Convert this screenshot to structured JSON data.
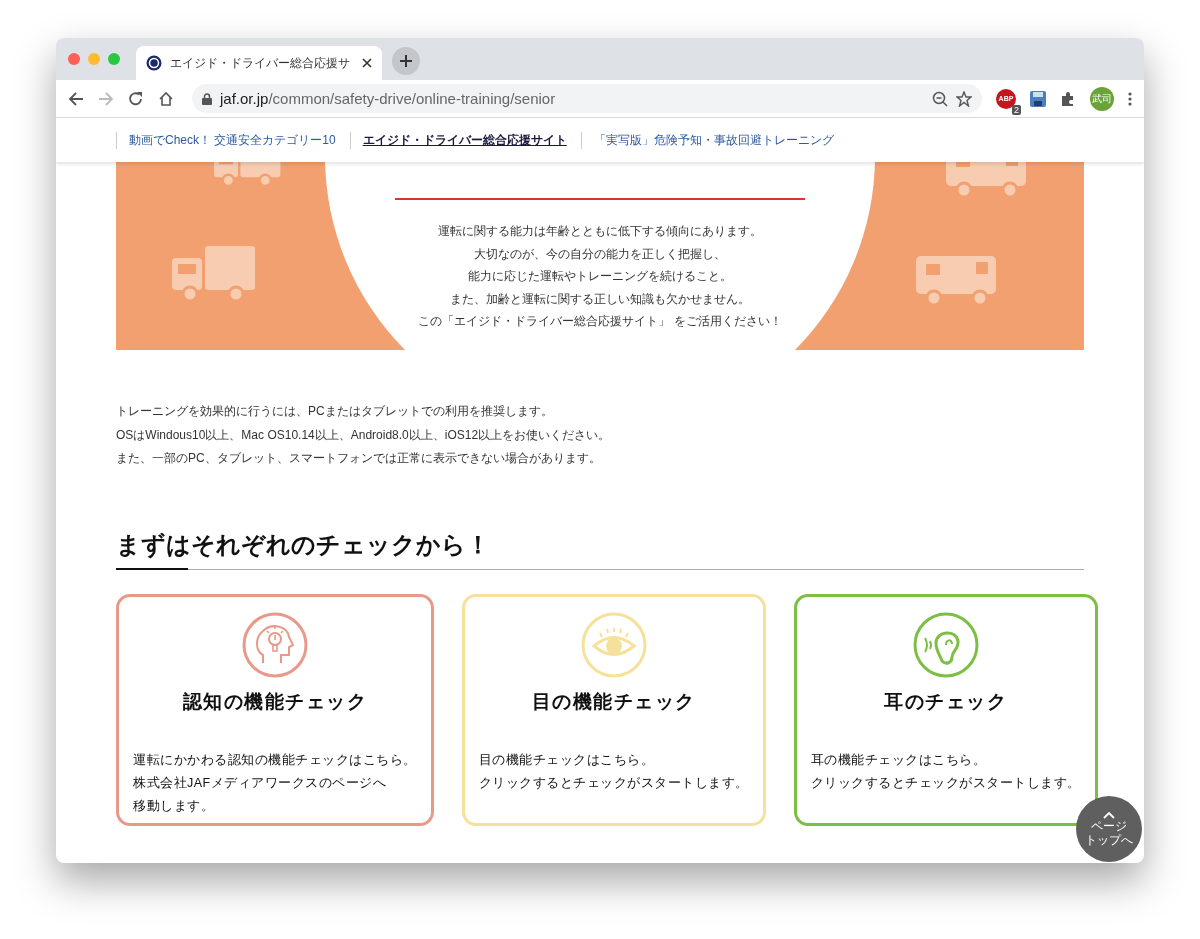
{
  "browser": {
    "tab_title": "エイジド・ドライバー総合応援サ",
    "url_domain": "jaf.or.jp",
    "url_path": "/common/safety-drive/online-training/senior",
    "extension_label": "ABP",
    "extension_badge": "2",
    "profile": "武司"
  },
  "nav_links": [
    {
      "label": "動画でCheck！ 交通安全カテゴリー10",
      "selected": false
    },
    {
      "label": "エイジド・ドライバー総合応援サイト",
      "selected": true
    },
    {
      "label": "「実写版」危険予知・事故回避トレーニング",
      "selected": false
    }
  ],
  "banner": {
    "lines": [
      "運転に関する能力は年齢とともに低下する傾向にあります。",
      "大切なのが、今の自分の能力を正しく把握し、",
      "能力に応じた運転やトレーニングを続けること。",
      "また、加齢と運転に関する正しい知識も欠かせません。",
      "この「エイジド・ドライバー総合応援サイト」 をご活用ください！"
    ]
  },
  "intro": [
    "トレーニングを効果的に行うには、PCまたはタブレットでの利用を推奨します。",
    "OSはWindous10以上、Mac OS10.14以上、Android8.0以上、iOS12以上をお使いください。",
    "また、一部のPC、タブレット、スマートフォンでは正常に表示できない場合があります。"
  ],
  "section_heading": "まずはそれぞれのチェックから！",
  "cards": [
    {
      "kind": "brain",
      "color": "#e8998a",
      "title": "認知の機能チェック",
      "description": [
        "運転にかかわる認知の機能チェックはこちら。",
        "株式会社JAFメディアワークスのページへ",
        "移動します。"
      ]
    },
    {
      "kind": "eye",
      "color": "#f5e19a",
      "title": "目の機能チェック",
      "description": [
        "目の機能チェックはこちら。",
        "クリックするとチェックがスタートします。"
      ]
    },
    {
      "kind": "ear",
      "color": "#7dbf44",
      "title": "耳のチェック",
      "description": [
        "耳の機能チェックはこちら。",
        "クリックするとチェックがスタートします。"
      ]
    }
  ],
  "page_top": [
    "ページ",
    "トップへ"
  ]
}
